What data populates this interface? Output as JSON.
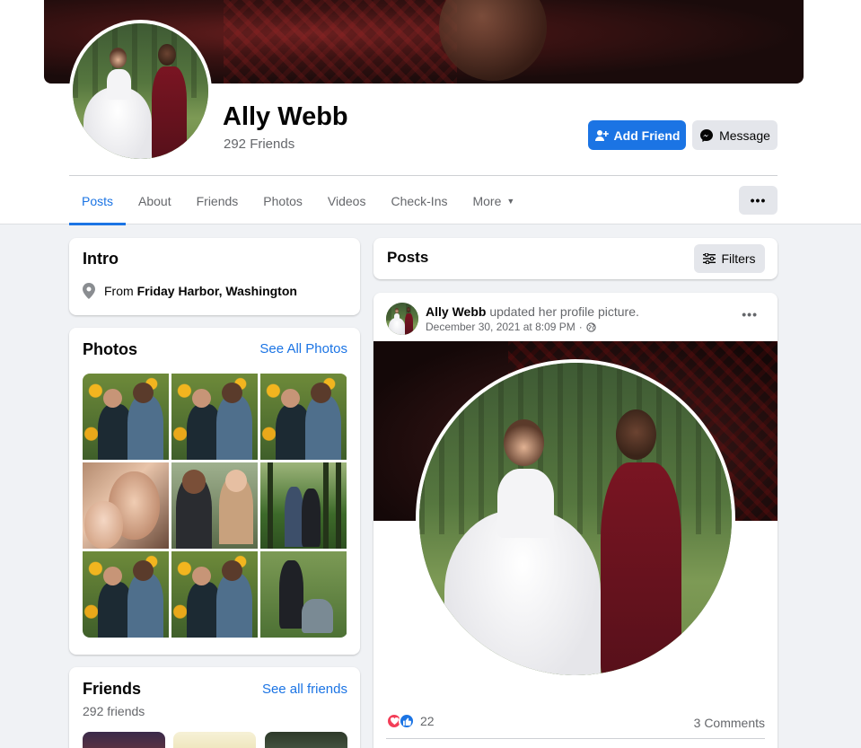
{
  "profile": {
    "name": "Ally Webb",
    "friends_count": "292 Friends",
    "add_friend_label": "Add Friend",
    "message_label": "Message"
  },
  "tabs": [
    {
      "label": "Posts",
      "active": true
    },
    {
      "label": "About"
    },
    {
      "label": "Friends"
    },
    {
      "label": "Photos"
    },
    {
      "label": "Videos"
    },
    {
      "label": "Check-Ins"
    },
    {
      "label": "More"
    }
  ],
  "more_menu_icon": "ellipsis-icon",
  "intro": {
    "title": "Intro",
    "from_prefix": "From",
    "from_place": "Friday Harbor, Washington",
    "icon": "location-pin-icon"
  },
  "photos": {
    "title": "Photos",
    "see_all": "See All Photos"
  },
  "friends": {
    "title": "Friends",
    "see_all": "See all friends",
    "count": "292 friends"
  },
  "posts_header": {
    "title": "Posts",
    "filters_label": "Filters"
  },
  "post": {
    "author": "Ally Webb",
    "action": "updated her profile picture.",
    "date": "December 30, 2021 at 8:09 PM",
    "separator": "·",
    "reaction_count": "22",
    "comments": "3 Comments"
  },
  "colors": {
    "accent": "#1b74e4",
    "page_bg": "#f0f2f5",
    "love": "#f33e58"
  }
}
